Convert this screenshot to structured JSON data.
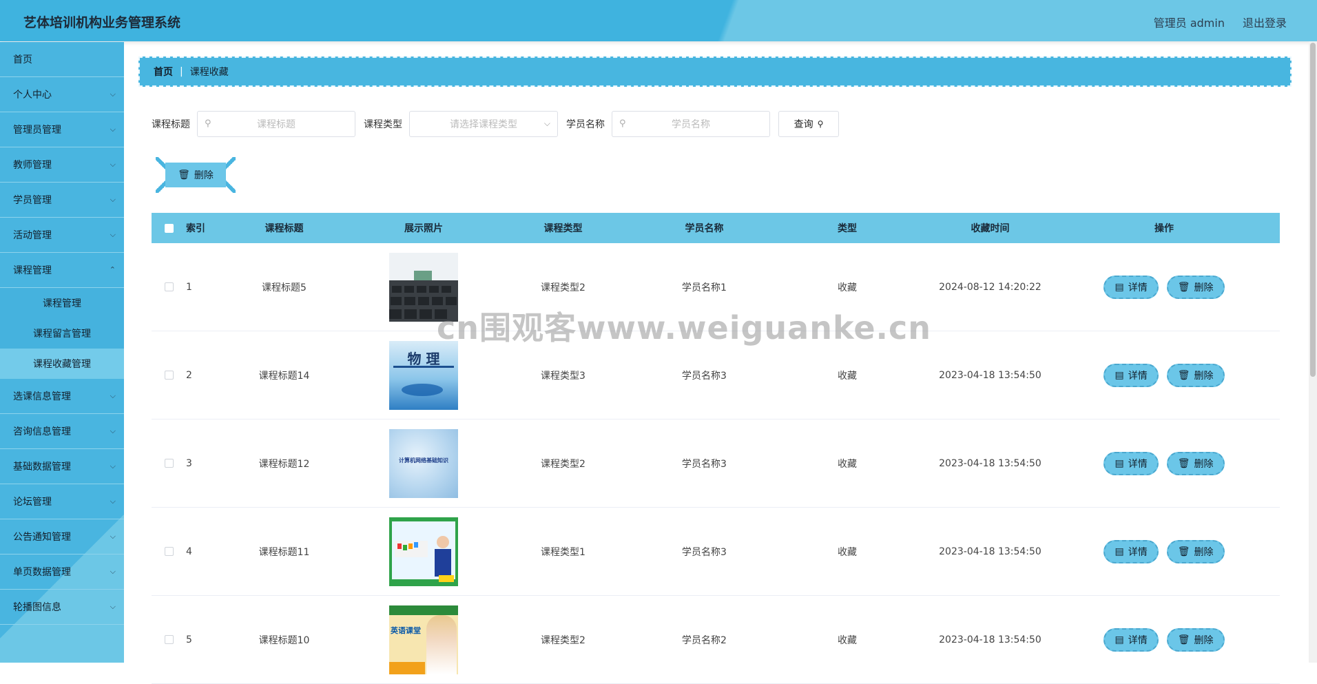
{
  "header": {
    "title": "艺体培训机构业务管理系统",
    "user_label": "管理员 admin",
    "logout_label": "退出登录"
  },
  "sidebar": {
    "items": [
      {
        "label": "首页"
      },
      {
        "label": "个人中心"
      },
      {
        "label": "管理员管理"
      },
      {
        "label": "教师管理"
      },
      {
        "label": "学员管理"
      },
      {
        "label": "活动管理"
      },
      {
        "label": "课程管理"
      },
      {
        "label": "选课信息管理"
      },
      {
        "label": "咨询信息管理"
      },
      {
        "label": "基础数据管理"
      },
      {
        "label": "论坛管理"
      },
      {
        "label": "公告通知管理"
      },
      {
        "label": "单页数据管理"
      },
      {
        "label": "轮播图信息"
      }
    ],
    "sub_items": [
      {
        "label": "课程管理"
      },
      {
        "label": "课程留言管理"
      },
      {
        "label": "课程收藏管理"
      }
    ]
  },
  "breadcrumb": {
    "home": "首页",
    "current": "课程收藏"
  },
  "search": {
    "title_label": "课程标题",
    "title_placeholder": "课程标题",
    "type_label": "课程类型",
    "type_placeholder": "请选择课程类型",
    "student_label": "学员名称",
    "student_placeholder": "学员名称",
    "query_label": "查询"
  },
  "toolbar": {
    "delete_label": "删除"
  },
  "table": {
    "headers": {
      "index": "索引",
      "title": "课程标题",
      "photo": "展示照片",
      "type": "课程类型",
      "student": "学员名称",
      "kind": "类型",
      "time": "收藏时间",
      "ops": "操作"
    },
    "detail_label": "详情",
    "delete_label": "删除",
    "rows": [
      {
        "index": "1",
        "title": "课程标题5",
        "type": "课程类型2",
        "student": "学员名称1",
        "kind": "收藏",
        "time": "2024-08-12 14:20:22",
        "photo_text": ""
      },
      {
        "index": "2",
        "title": "课程标题14",
        "type": "课程类型3",
        "student": "学员名称3",
        "kind": "收藏",
        "time": "2023-04-18 13:54:50",
        "photo_text": "物 理"
      },
      {
        "index": "3",
        "title": "课程标题12",
        "type": "课程类型2",
        "student": "学员名称3",
        "kind": "收藏",
        "time": "2023-04-18 13:54:50",
        "photo_text": "计算机网络基础知识"
      },
      {
        "index": "4",
        "title": "课程标题11",
        "type": "课程类型1",
        "student": "学员名称3",
        "kind": "收藏",
        "time": "2023-04-18 13:54:50",
        "photo_text": ""
      },
      {
        "index": "5",
        "title": "课程标题10",
        "type": "课程类型2",
        "student": "学员名称2",
        "kind": "收藏",
        "time": "2023-04-18 13:54:50",
        "photo_text": "英语课堂"
      }
    ]
  },
  "watermark": "cn围观客www.weiguanke.cn"
}
